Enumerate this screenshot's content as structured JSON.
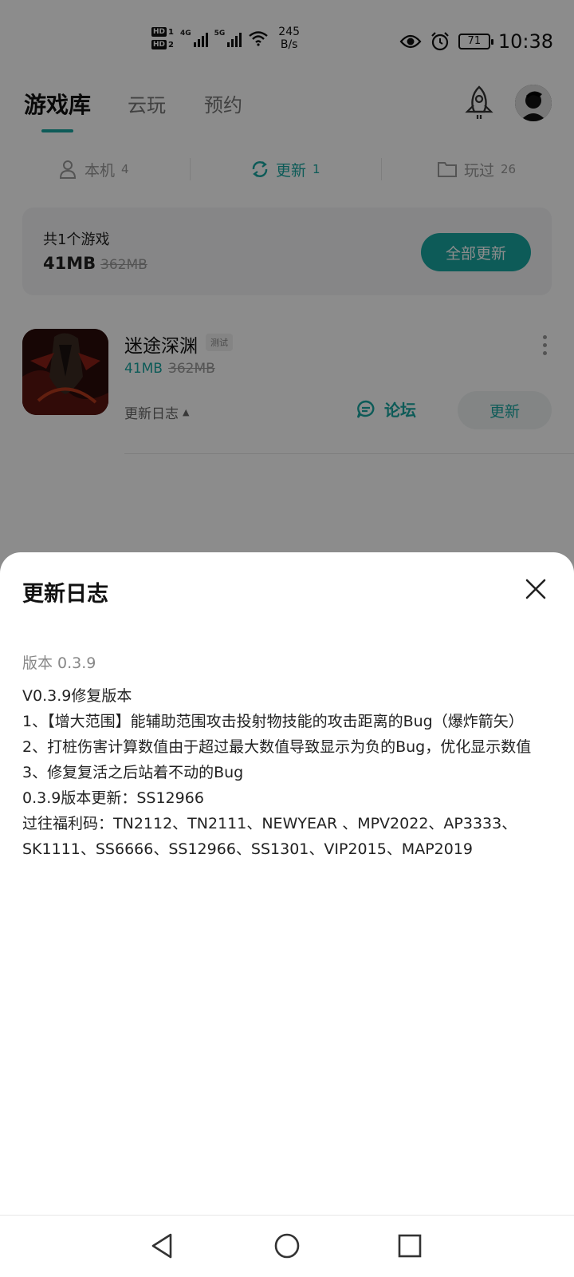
{
  "status_bar": {
    "hd1": "HD",
    "sim1": "1",
    "hd2": "HD",
    "sim2": "2",
    "net1": "4G",
    "net2": "5G",
    "speed_value": "245",
    "speed_unit": "B/s",
    "battery": "71",
    "time": "10:38"
  },
  "top_nav": {
    "tabs": [
      {
        "label": "游戏库"
      },
      {
        "label": "云玩"
      },
      {
        "label": "预约"
      }
    ],
    "active_tab": "游戏库"
  },
  "sub_tabs": [
    {
      "label": "本机",
      "count": "4"
    },
    {
      "label": "更新",
      "count": "1"
    },
    {
      "label": "玩过",
      "count": "26"
    }
  ],
  "summary": {
    "title": "共1个游戏",
    "size": "41MB",
    "original_size": "362MB",
    "update_all_label": "全部更新"
  },
  "game": {
    "name": "迷途深渊",
    "badge": "测试",
    "size": "41MB",
    "original_size": "362MB",
    "changelog_label": "更新日志",
    "changelog_arrow": "▲",
    "forum_label": "论坛",
    "update_label": "更新"
  },
  "changelog_sheet": {
    "title": "更新日志",
    "version": "版本 0.3.9",
    "lines": [
      "V0.3.9修复版本",
      "1、【增大范围】能辅助范围攻击投射物技能的攻击距离的Bug（爆炸箭矢）",
      "2、打桩伤害计算数值由于超过最大数值导致显示为负的Bug，优化显示数值",
      "3、修复复活之后站着不动的Bug",
      "0.3.9版本更新：SS12966",
      "过往福利码：TN2112、TN2111、NEWYEAR 、MPV2022、AP3333、SK1111、SS6666、SS12966、SS1301、VIP2015、MAP2019"
    ]
  },
  "colors": {
    "accent": "#19a6a0",
    "overlay": "rgba(0,0,0,0.45)"
  },
  "icons": {
    "close": "close-icon",
    "rocket": "rocket-icon",
    "refresh": "refresh-icon",
    "folder": "folder-icon",
    "device": "device-icon",
    "forum": "chat-bubble-icon"
  }
}
